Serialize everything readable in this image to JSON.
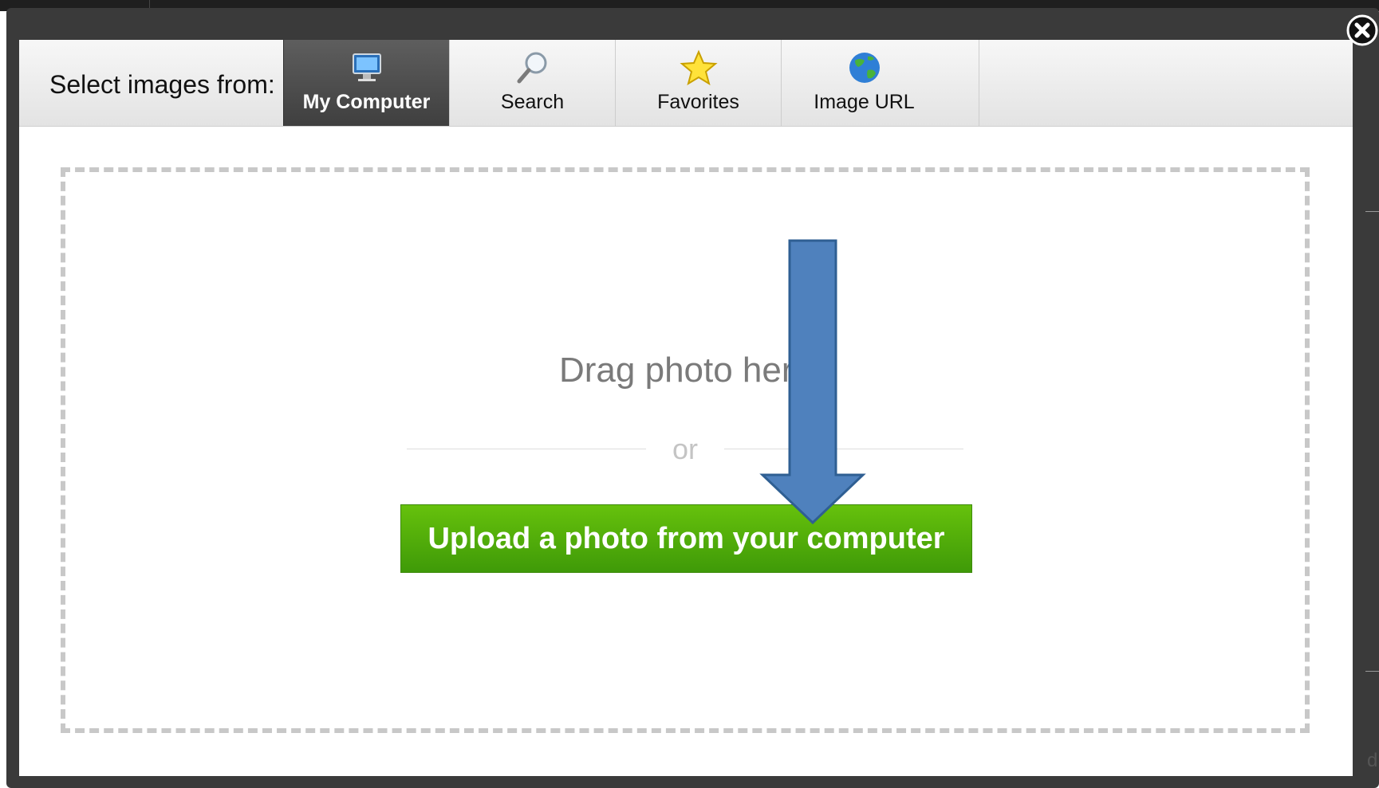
{
  "tabbar": {
    "label": "Select images from:",
    "tabs": [
      {
        "label": "My Computer",
        "icon": "monitor-icon",
        "active": true
      },
      {
        "label": "Search",
        "icon": "magnifier-icon",
        "active": false
      },
      {
        "label": "Favorites",
        "icon": "star-icon",
        "active": false
      },
      {
        "label": "Image URL",
        "icon": "globe-icon",
        "active": false
      }
    ]
  },
  "dropzone": {
    "drag_text": "Drag photo here",
    "or_text": "or",
    "upload_button": "Upload a photo from your computer"
  },
  "annotation": {
    "icon": "down-arrow-icon",
    "color": "#4f81bd"
  },
  "colors": {
    "upload_green": "#4fae0a",
    "active_tab": "#4a4a4a"
  },
  "corner_text": "d"
}
